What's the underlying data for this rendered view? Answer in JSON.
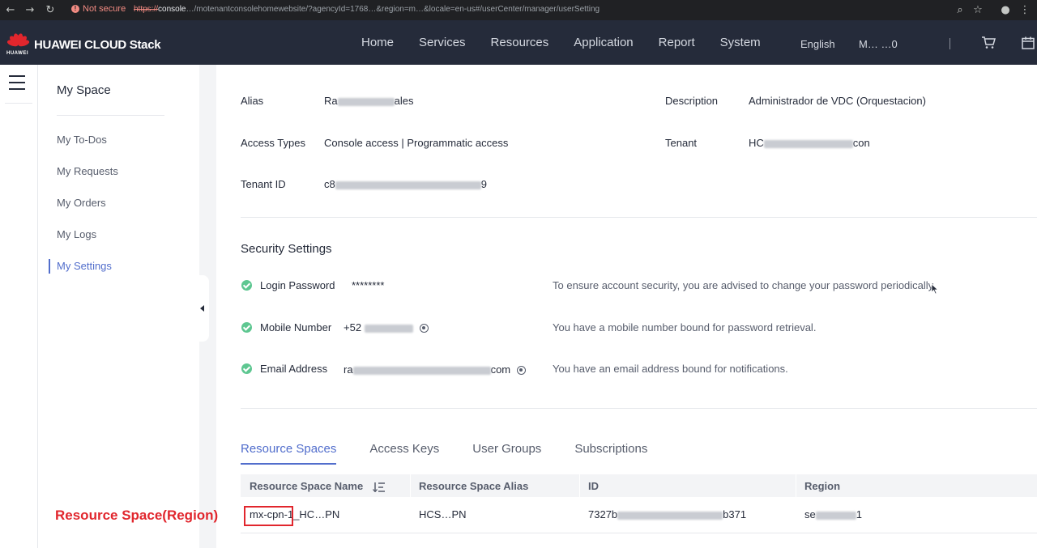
{
  "browser": {
    "security": "Not secure",
    "url_scheme": "https://",
    "url_host": "console",
    "url_rest": "…/motenantconsolehomewebsite/?agencyId=1768…&region=m…&locale=en-us#/userCenter/manager/userSetting"
  },
  "header": {
    "logo_text": "HUAWEI CLOUD Stack",
    "logo_sub": "HUAWEI",
    "nav": [
      "Home",
      "Services",
      "Resources",
      "Application",
      "Report",
      "System"
    ],
    "language": "English",
    "user": "M… …0"
  },
  "sidebar": {
    "title": "My Space",
    "items": [
      {
        "label": "My To-Dos"
      },
      {
        "label": "My Requests"
      },
      {
        "label": "My Orders"
      },
      {
        "label": "My Logs"
      },
      {
        "label": "My Settings",
        "active": true
      }
    ]
  },
  "profile": {
    "alias_label": "Alias",
    "alias_prefix": "Ra",
    "alias_suffix": "ales",
    "description_label": "Description",
    "description_value": "Administrador de VDC (Orquestacion)",
    "access_types_label": "Access Types",
    "access_types_value": "Console access | Programmatic access",
    "tenant_label": "Tenant",
    "tenant_prefix": "HC",
    "tenant_suffix": "con",
    "tenant_id_label": "Tenant ID",
    "tenant_id_prefix": "c8",
    "tenant_id_suffix": "9"
  },
  "security": {
    "title": "Security Settings",
    "items": [
      {
        "label": "Login Password",
        "value": "********",
        "note": "To ensure account security, you are advised to change your password periodically."
      },
      {
        "label": "Mobile Number",
        "value": "+52",
        "note": "You have a mobile number bound for password retrieval."
      },
      {
        "label": "Email Address",
        "value_prefix": "ra",
        "value_suffix": "com",
        "note": "You have an email address bound for notifications."
      }
    ]
  },
  "tabs": [
    "Resource Spaces",
    "Access Keys",
    "User Groups",
    "Subscriptions"
  ],
  "table": {
    "columns": [
      "Resource Space Name",
      "Resource Space Alias",
      "ID",
      "Region"
    ],
    "row": {
      "name_highlight": "mx-cpn-1",
      "name_rest": "_HC…PN",
      "alias": "HCS…PN",
      "id_prefix": "7327b",
      "id_suffix": "b371",
      "region_prefix": "se",
      "region_suffix": "1"
    }
  },
  "annotation": "Resource Space(Region)",
  "colors": {
    "accent": "#526ecc",
    "header_bg": "#252b3a",
    "success": "#5ec791",
    "highlight": "#e1262d"
  }
}
